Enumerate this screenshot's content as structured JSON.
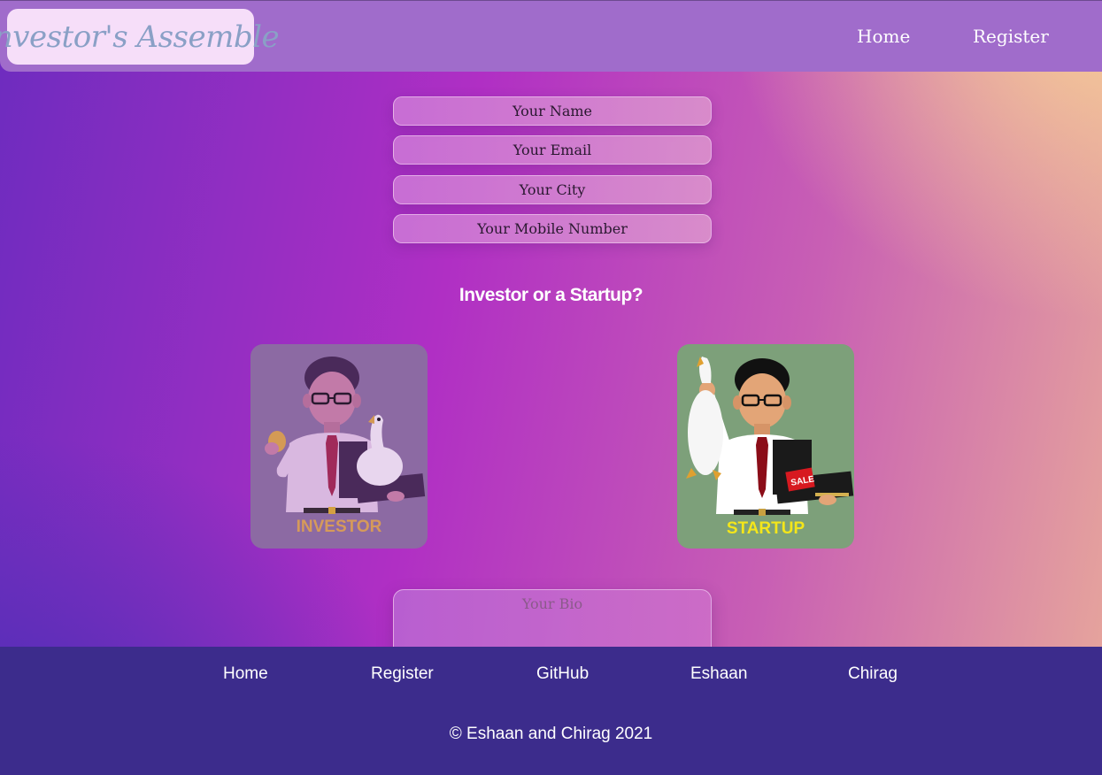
{
  "header": {
    "logo_text": "Investor's Assemble",
    "nav": {
      "home": "Home",
      "register": "Register"
    }
  },
  "form": {
    "name_placeholder": "Your Name",
    "email_placeholder": "Your Email",
    "city_placeholder": "Your City",
    "mobile_placeholder": "Your Mobile Number",
    "question": "Investor or a Startup?",
    "bio_placeholder": "Your Bio"
  },
  "cards": {
    "investor_label": "INVESTOR",
    "startup_label": "STARTUP",
    "sale_tag": "SALE"
  },
  "footer": {
    "links": [
      "Home",
      "Register",
      "GitHub",
      "Eshaan",
      "Chirag"
    ],
    "copyright": "© Eshaan and Chirag 2021"
  },
  "colors": {
    "header_bg": "#a06ccb",
    "footer_bg": "#3c2c8c",
    "investor_card_bg": "#8c6aa3",
    "startup_card_bg": "#7da07a",
    "startup_label": "#f4e61a",
    "investor_label": "#d69a5a"
  }
}
